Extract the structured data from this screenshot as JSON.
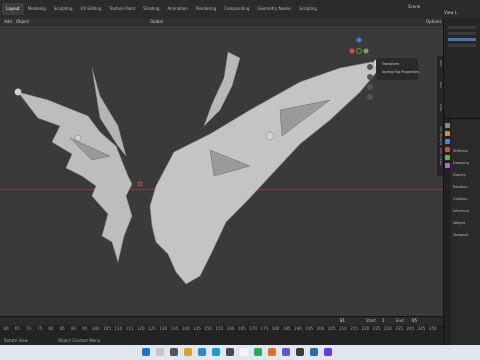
{
  "app": {
    "menu_tabs": [
      "Layout",
      "Modeling",
      "Sculpting",
      "UV Editing",
      "Texture Paint",
      "Shading",
      "Animation",
      "Rendering",
      "Compositing",
      "Geometry Nodes",
      "Scripting"
    ],
    "scene_label": "Scene",
    "view_layer_label": "View L"
  },
  "header": {
    "add_label": "Add",
    "object_label": "Object",
    "orientation_label": "Global",
    "options_label": "Options"
  },
  "n_panel": {
    "transform_label": "Transform",
    "spring_rig_label": "Spring Rig Properties"
  },
  "side_tabs": [
    "Item",
    "Tool",
    "View",
    "CGC Pipeline",
    "CGC Create"
  ],
  "properties_rows": [
    "Stiffness",
    "Damping",
    "Gravity",
    "Rotation",
    "Collision",
    "Influence",
    "Weight",
    "Viewport"
  ],
  "timeline": {
    "frames": [
      "60",
      "65",
      "70",
      "75",
      "80",
      "85",
      "90",
      "95",
      "100",
      "105",
      "110",
      "115",
      "120",
      "125",
      "130",
      "135",
      "140",
      "145",
      "150",
      "155",
      "160",
      "165",
      "170",
      "175",
      "180",
      "185",
      "190",
      "195",
      "200",
      "205",
      "210",
      "215",
      "220",
      "225",
      "230",
      "235",
      "240",
      "245",
      "250"
    ],
    "current_frame": "81",
    "start_label": "Start",
    "start_value": "1",
    "end_label": "End",
    "end_value": "95",
    "current_value": "81"
  },
  "status": {
    "rotate_view": "Rotate View",
    "context_menu": "Object Context Menu"
  },
  "colors": {
    "viewport_bg": "#3a3a3a",
    "accent": "#4772b3",
    "x_axis": "#a33d3d",
    "y_axis": "#6a9a3a",
    "mesh": "#c8c8c8"
  }
}
